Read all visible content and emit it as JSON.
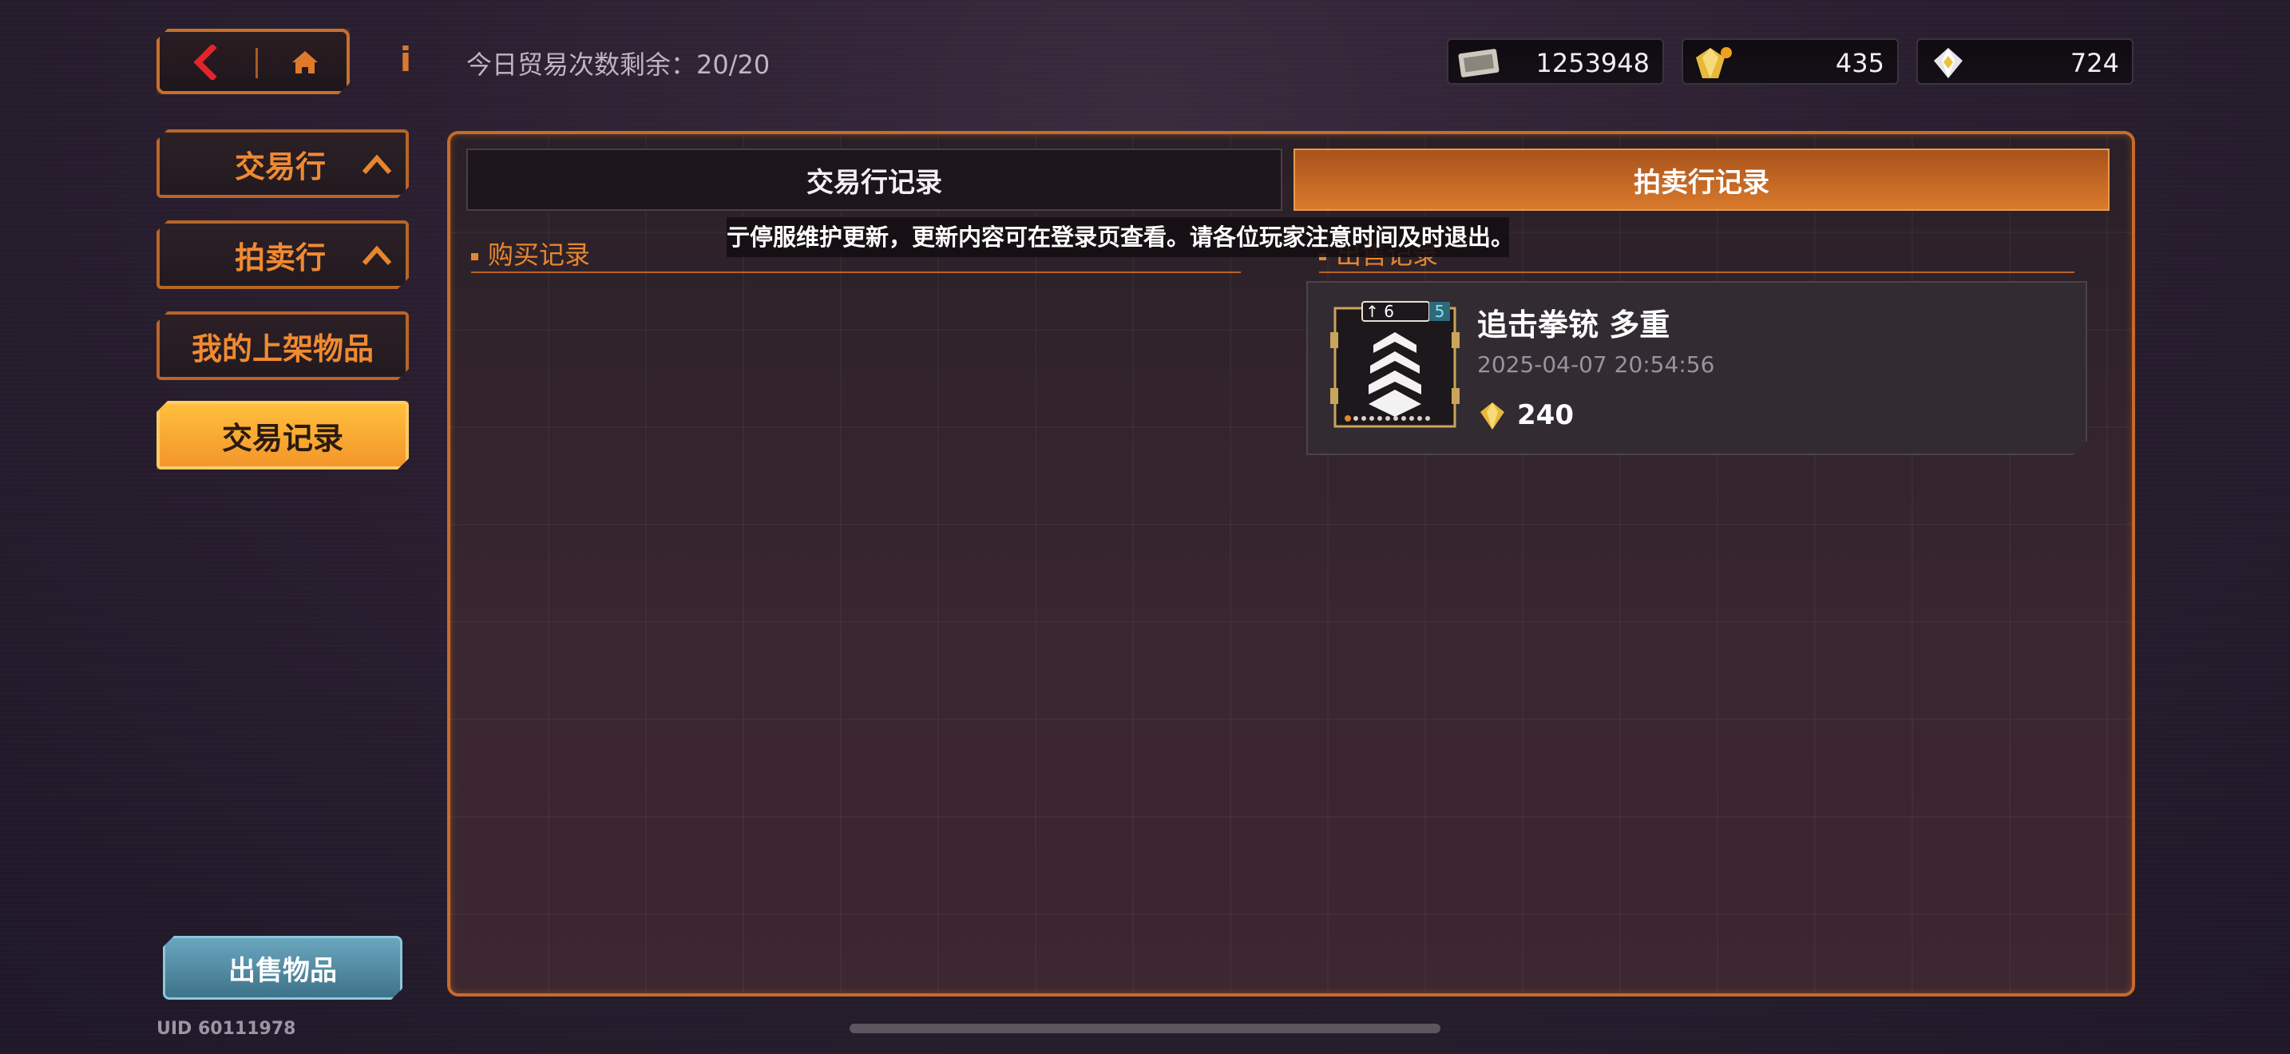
{
  "header": {
    "trade_count_label": "今日贸易次数剩余：20/20",
    "currencies": [
      {
        "name": "ticket-currency",
        "value": "1253948"
      },
      {
        "name": "gold-gem-currency",
        "value": "435"
      },
      {
        "name": "diamond-currency",
        "value": "724"
      }
    ]
  },
  "sidebar": {
    "items": [
      {
        "label": "交易行",
        "active": false
      },
      {
        "label": "拍卖行",
        "active": false
      },
      {
        "label": "我的上架物品",
        "active": false
      },
      {
        "label": "交易记录",
        "active": true
      }
    ],
    "sell_button": "出售物品",
    "uid": "UID 60111978"
  },
  "main": {
    "tabs": [
      {
        "label": "交易行记录",
        "active": false
      },
      {
        "label": "拍卖行记录",
        "active": true
      }
    ],
    "purchase_section": "购买记录",
    "sale_section": "出售记录",
    "notice": "亍停服维护更新，更新内容可在登录页查看。请各位玩家注意时间及时退出。",
    "items": [
      {
        "name": "追击拳铳 多重",
        "time": "2025-04-07 20:54:56",
        "price": "240",
        "level": "6",
        "badge": "5"
      }
    ]
  },
  "colors": {
    "accent": "#e5862f",
    "active_gold": "#f3962a",
    "sell_button": "#4f8aa2"
  }
}
